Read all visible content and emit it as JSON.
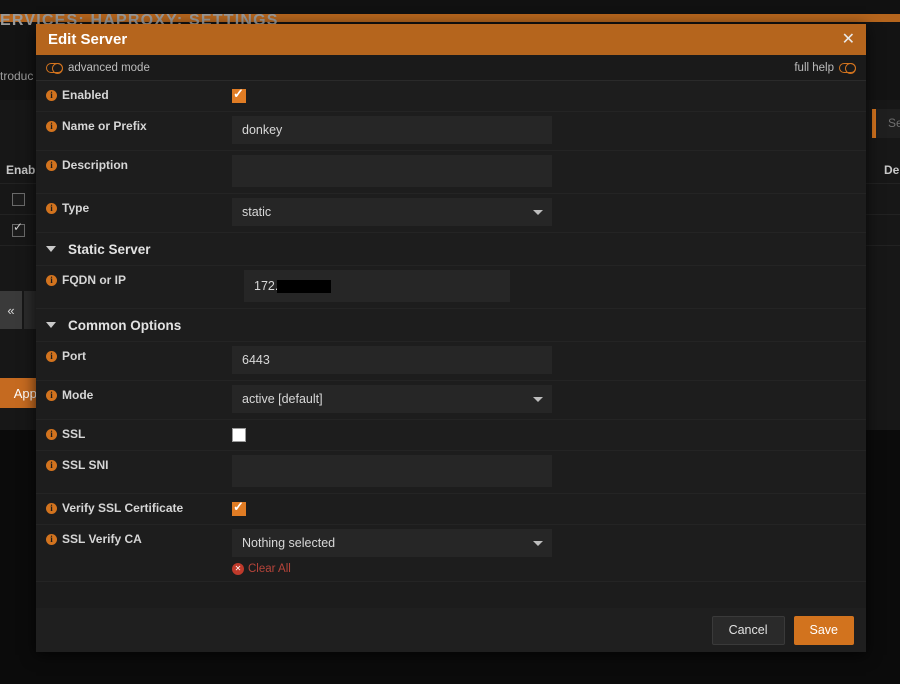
{
  "background": {
    "breadcrumb": "ERVICES: HAPROXY: SETTINGS",
    "intro_text": "troduc",
    "search_placeholder": "Se",
    "column_enabled": "Enab",
    "column_description": "De",
    "collapse_label": "«",
    "apply_label": "Apply"
  },
  "modal": {
    "title": "Edit Server",
    "close_icon": "close-icon",
    "advanced_mode_label": "advanced mode",
    "full_help_label": "full help",
    "fields": {
      "enabled": {
        "label": "Enabled",
        "checked": true
      },
      "name_or_prefix": {
        "label": "Name or Prefix",
        "value": "donkey"
      },
      "description": {
        "label": "Description",
        "value": ""
      },
      "type": {
        "label": "Type",
        "value": "static"
      },
      "fqdn_or_ip": {
        "label": "FQDN or IP",
        "value": "172."
      },
      "port": {
        "label": "Port",
        "value": "6443"
      },
      "mode": {
        "label": "Mode",
        "value": "active [default]"
      },
      "ssl": {
        "label": "SSL",
        "checked": false
      },
      "ssl_sni": {
        "label": "SSL SNI",
        "value": ""
      },
      "verify_ssl_certificate": {
        "label": "Verify SSL Certificate",
        "checked": true
      },
      "ssl_verify_ca": {
        "label": "SSL Verify CA",
        "value": "Nothing selected"
      }
    },
    "sections": {
      "static_server": "Static Server",
      "common_options": "Common Options"
    },
    "clear_all_label": "Clear All",
    "footer": {
      "cancel_label": "Cancel",
      "save_label": "Save"
    }
  },
  "colors": {
    "accent": "#d2731e",
    "header": "#b5651d",
    "danger": "#b5443a",
    "panel": "#1c1c1c",
    "input": "#262626"
  }
}
